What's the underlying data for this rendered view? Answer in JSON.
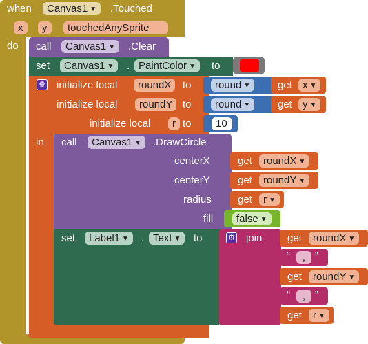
{
  "event": {
    "when_label": "when",
    "component": "Canvas1",
    "event_name": ".Touched",
    "params": [
      "x",
      "y",
      "touchedAnySprite"
    ],
    "do_label": "do"
  },
  "clear_block": {
    "call_label": "call",
    "component": "Canvas1",
    "method": ".Clear"
  },
  "set_paint": {
    "set_label": "set",
    "component": "Canvas1",
    "dot": ".",
    "property": "PaintColor",
    "to_label": "to",
    "color": "#ff0000"
  },
  "init_local": {
    "rows": [
      {
        "label": "initialize local",
        "var": "roundX",
        "to_label": "to",
        "fn": "round",
        "get_label": "get",
        "arg": "x"
      },
      {
        "label": "initialize local",
        "var": "roundY",
        "to_label": "to",
        "fn": "round",
        "get_label": "get",
        "arg": "y"
      },
      {
        "label": "initialize local",
        "var": "r",
        "to_label": "to",
        "number": "10"
      }
    ],
    "in_label": "in"
  },
  "draw_circle": {
    "call_label": "call",
    "component": "Canvas1",
    "method": ".DrawCircle",
    "args": [
      {
        "name": "centerX",
        "get_label": "get",
        "var": "roundX"
      },
      {
        "name": "centerY",
        "get_label": "get",
        "var": "roundY"
      },
      {
        "name": "radius",
        "get_label": "get",
        "var": "r"
      }
    ],
    "fill_label": "fill",
    "fill_value": "false"
  },
  "set_label_text": {
    "set_label": "set",
    "component": "Label1",
    "dot": ".",
    "property": "Text",
    "to_label": "to",
    "join_label": "join",
    "items": [
      {
        "get_label": "get",
        "var": "roundX"
      },
      {
        "text": ","
      },
      {
        "get_label": "get",
        "var": "roundY"
      },
      {
        "text": ","
      },
      {
        "get_label": "get",
        "var": "r"
      }
    ]
  },
  "colors": {
    "event": "#b1942a",
    "canvas_method": "#7c5a9c",
    "setter": "#2f6b4e",
    "local": "#d75d27",
    "math": "#3c6fb1",
    "logic": "#77b52d",
    "text": "#b42d69"
  },
  "icons": [
    "gear-icon",
    "dropdown-arrow-icon"
  ]
}
